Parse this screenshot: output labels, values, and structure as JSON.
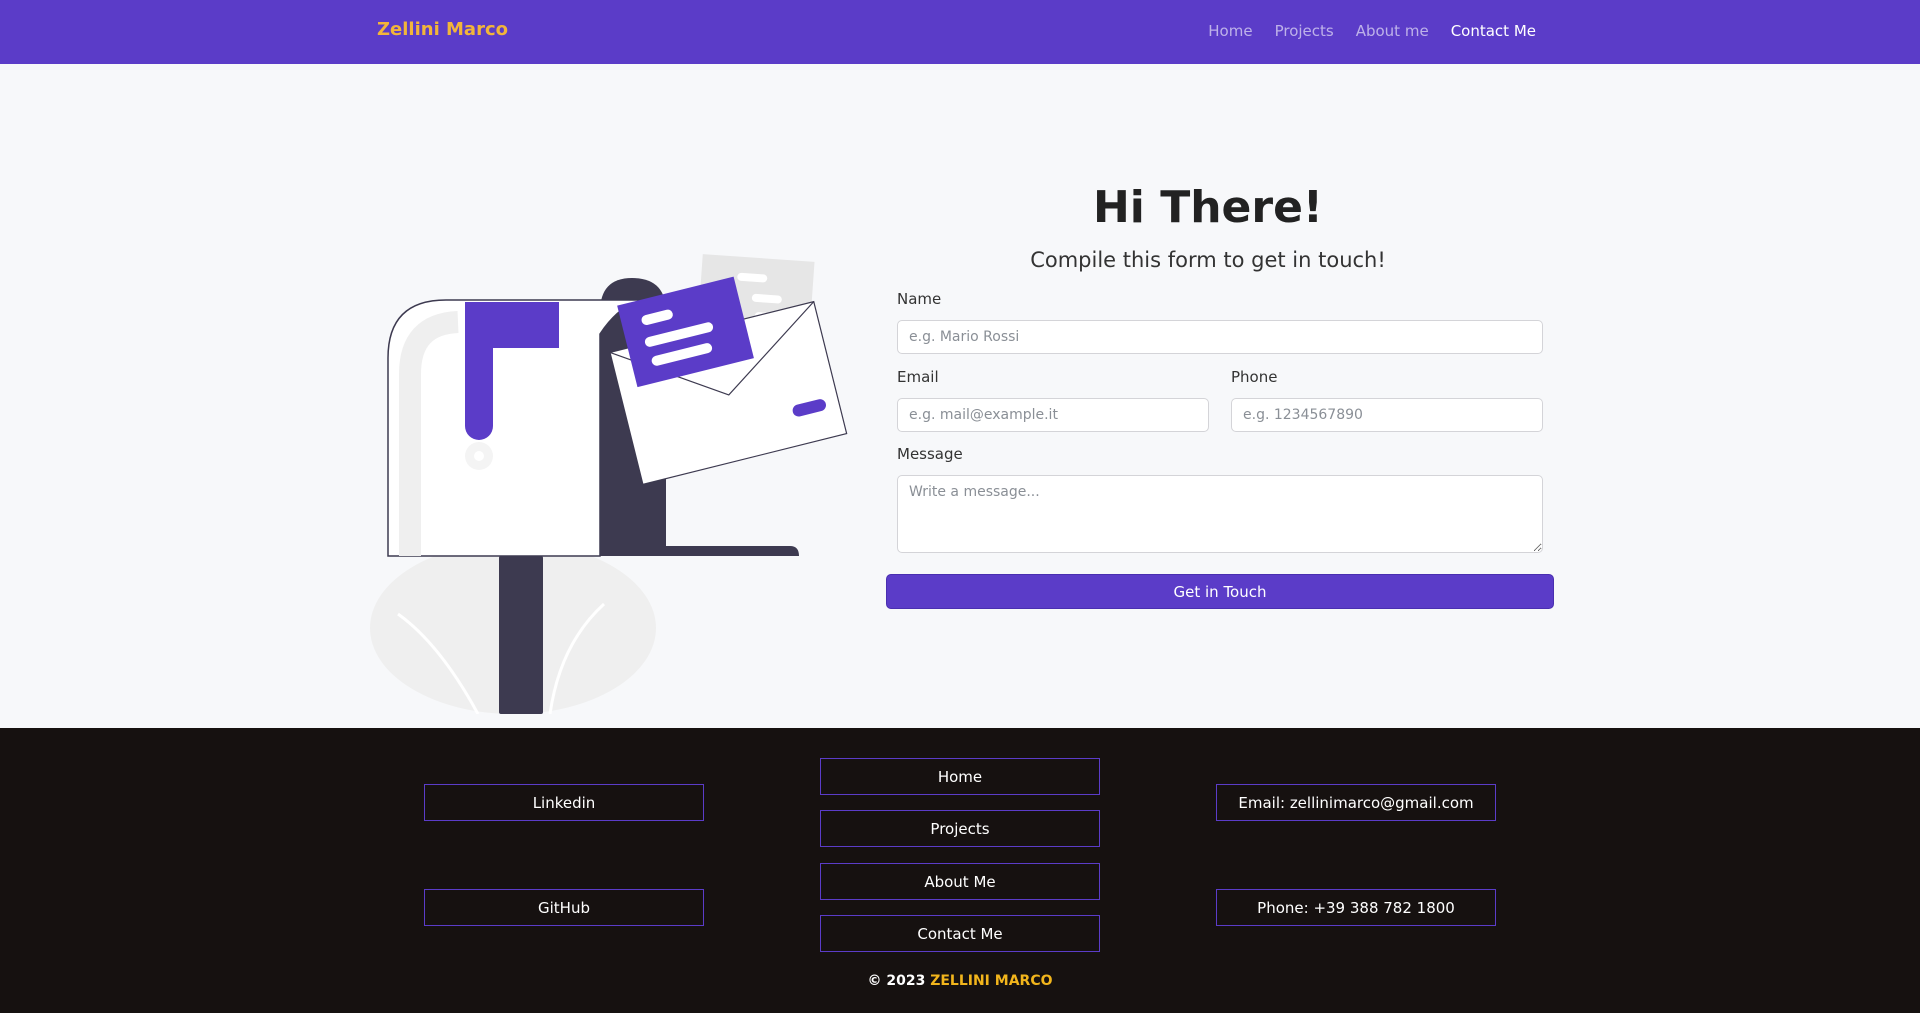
{
  "navbar": {
    "brand": "Zellini Marco",
    "links": [
      {
        "label": "Home"
      },
      {
        "label": "Projects"
      },
      {
        "label": "About me"
      },
      {
        "label": "Contact Me"
      }
    ]
  },
  "hero": {
    "title": "Hi There!",
    "subtitle": "Compile this form to get in touch!"
  },
  "form": {
    "name_label": "Name",
    "name_placeholder": "e.g. Mario Rossi",
    "email_label": "Email",
    "email_placeholder": "e.g. mail@example.it",
    "phone_label": "Phone",
    "phone_placeholder": "e.g. 1234567890",
    "message_label": "Message",
    "message_placeholder": "Write a message...",
    "submit_label": "Get in Touch"
  },
  "footer": {
    "social": {
      "linkedin": "Linkedin",
      "github": "GitHub"
    },
    "nav": {
      "home": "Home",
      "projects": "Projects",
      "about": "About Me",
      "contact": "Contact Me"
    },
    "contact": {
      "email": "Email: zellinimarco@gmail.com",
      "phone": "Phone: +39 388 782 1800"
    },
    "copyright_prefix": "© 2023",
    "copyright_name": "ZELLINI MARCO"
  },
  "colors": {
    "brand_purple": "#5b3cc8",
    "brand_gold": "#f2b53a",
    "footer_bg": "#161110",
    "page_bg": "#f7f8fa"
  },
  "icons": [
    "mailbox-illustration"
  ]
}
